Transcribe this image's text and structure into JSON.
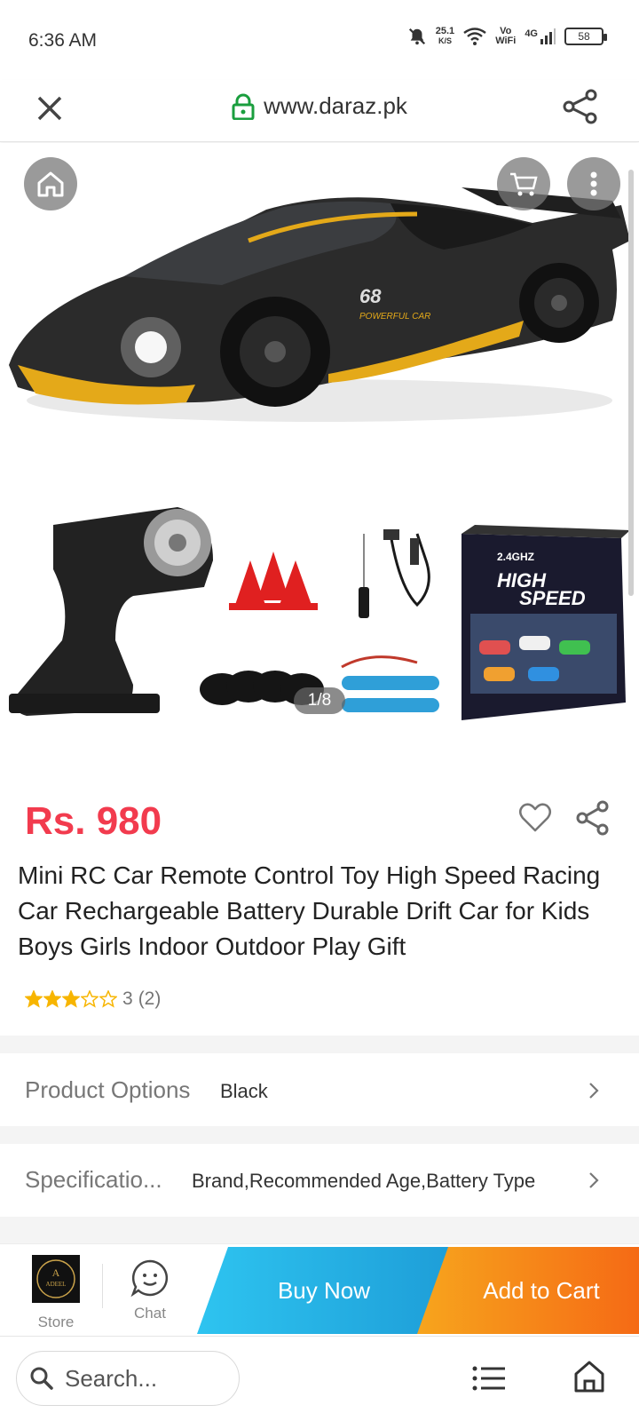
{
  "status_bar": {
    "time": "6:36 AM",
    "net_speed_value": "25.1",
    "net_speed_unit": "K/S",
    "vowifi_top": "Vo",
    "vowifi_bottom": "WiFi",
    "network": "4G",
    "battery": "58"
  },
  "browser": {
    "url": "www.daraz.pk"
  },
  "gallery": {
    "counter": "1/8",
    "box_text_line1": "2.4GHZ",
    "box_text_line2": "HIGH",
    "box_text_line3": "SPEED",
    "car_decal_number": "68",
    "car_decal_text": "POWERFUL CAR"
  },
  "product": {
    "price": "Rs. 980",
    "title": "Mini RC Car Remote Control Toy High Speed Racing Car Rechargeable Battery Durable Drift Car for Kids Boys Girls Indoor Outdoor Play Gift",
    "rating": 3,
    "rating_text": "3",
    "review_count": "(2)"
  },
  "options": {
    "label": "Product Options",
    "value": "Black"
  },
  "specifications": {
    "label": "Specificatio...",
    "value": "Brand,Recommended Age,Battery Type"
  },
  "actions": {
    "store_label": "Store",
    "store_logo_text": "ADEEL",
    "chat_label": "Chat",
    "buy_now": "Buy Now",
    "add_to_cart": "Add to Cart"
  },
  "bottom_nav": {
    "search_placeholder": "Search..."
  },
  "colors": {
    "price": "#f23b4e",
    "buy_now": "#1ea9e1",
    "add_to_cart": "#f57a18",
    "star": "#f7b500"
  }
}
